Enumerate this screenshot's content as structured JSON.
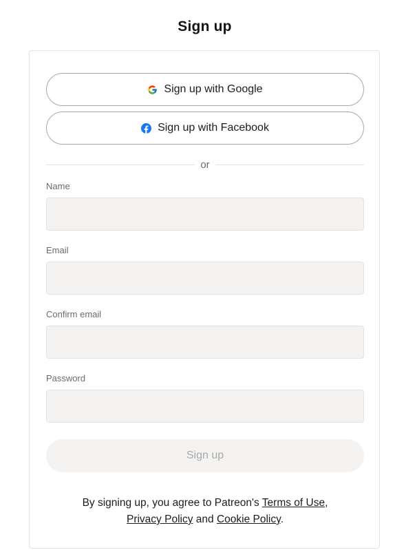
{
  "page": {
    "title": "Sign up"
  },
  "social": {
    "google_label": "Sign up with Google",
    "google_icon": "google-g-icon",
    "facebook_label": "Sign up with Facebook",
    "facebook_icon": "facebook-icon",
    "facebook_color": "#1877f2"
  },
  "divider": {
    "text": "or"
  },
  "form": {
    "name_label": "Name",
    "name_value": "",
    "email_label": "Email",
    "email_value": "",
    "confirm_email_label": "Confirm email",
    "confirm_email_value": "",
    "password_label": "Password",
    "password_value": "",
    "submit_label": "Sign up"
  },
  "legal": {
    "prefix": "By signing up, you agree to Patreon's ",
    "terms_link": "Terms of Use",
    "comma": ",",
    "privacy_link": "Privacy Policy",
    "and": " and ",
    "cookie_link": "Cookie Policy",
    "period": "."
  },
  "colors": {
    "input_background": "#f4f3f1",
    "border": "#e3e3e3",
    "text": "#1c1c1c",
    "muted_text": "#6b6b6b"
  }
}
